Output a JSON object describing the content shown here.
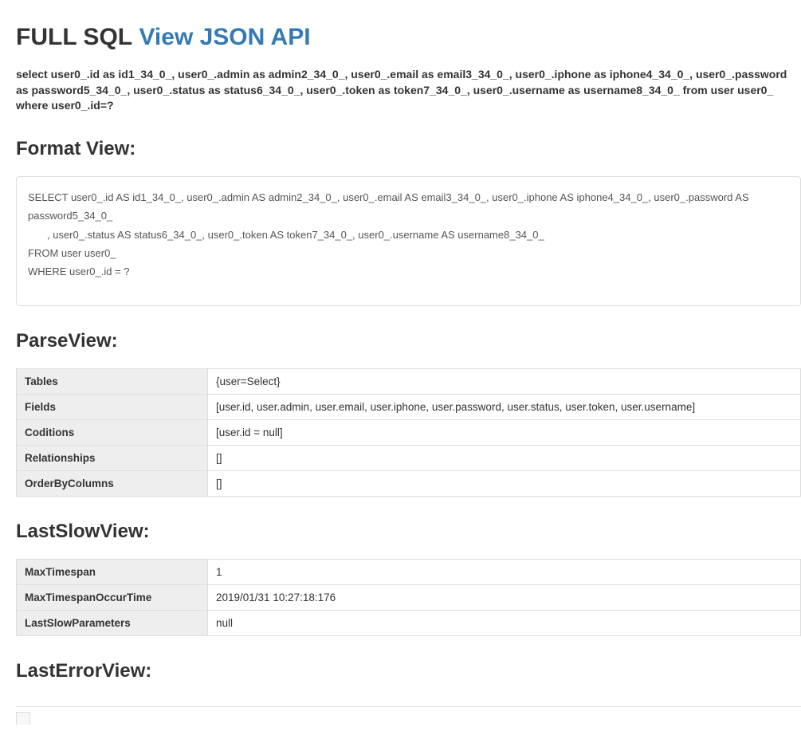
{
  "header": {
    "title": "FULL SQL",
    "link_label": "View JSON API"
  },
  "raw_sql": "select user0_.id as id1_34_0_, user0_.admin as admin2_34_0_, user0_.email as email3_34_0_, user0_.iphone as iphone4_34_0_, user0_.password as password5_34_0_, user0_.status as status6_34_0_, user0_.token as token7_34_0_, user0_.username as username8_34_0_ from user user0_ where user0_.id=?",
  "format_view": {
    "heading": "Format View:",
    "line1": "SELECT user0_.id AS id1_34_0_, user0_.admin AS admin2_34_0_, user0_.email AS email3_34_0_, user0_.iphone AS iphone4_34_0_, user0_.password AS password5_34_0_",
    "line2": ", user0_.status AS status6_34_0_, user0_.token AS token7_34_0_, user0_.username AS username8_34_0_",
    "line3": "FROM user user0_",
    "line4": "WHERE user0_.id = ?"
  },
  "parse_view": {
    "heading": "ParseView:",
    "rows": [
      {
        "key": "Tables",
        "val": "{user=Select}"
      },
      {
        "key": "Fields",
        "val": "[user.id, user.admin, user.email, user.iphone, user.password, user.status, user.token, user.username]"
      },
      {
        "key": "Coditions",
        "val": "[user.id = null]"
      },
      {
        "key": "Relationships",
        "val": "[]"
      },
      {
        "key": "OrderByColumns",
        "val": "[]"
      }
    ]
  },
  "last_slow_view": {
    "heading": "LastSlowView:",
    "rows": [
      {
        "key": "MaxTimespan",
        "val": "1"
      },
      {
        "key": "MaxTimespanOccurTime",
        "val": "2019/01/31 10:27:18:176"
      },
      {
        "key": "LastSlowParameters",
        "val": "null"
      }
    ]
  },
  "last_error_view": {
    "heading": "LastErrorView:"
  }
}
